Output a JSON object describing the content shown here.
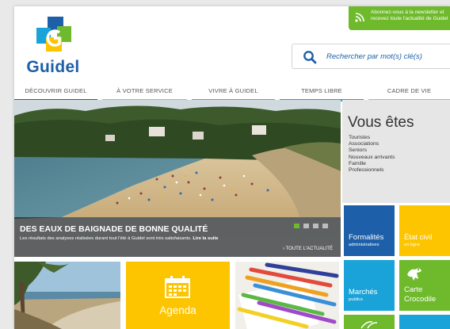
{
  "site": {
    "name": "Guidel"
  },
  "newsletter": {
    "text": "Abonnez-vous à la newsletter et recevez toute l'actualité de Guidel",
    "icon": "rss-icon"
  },
  "search": {
    "placeholder": "Rechercher par mot(s) clé(s)",
    "icon": "search-icon"
  },
  "nav": [
    {
      "label": "DÉCOUVRIR GUIDEL",
      "color": "#1d5fa8"
    },
    {
      "label": "À VOTRE SERVICE",
      "color": "#f5b400"
    },
    {
      "label": "VIVRE À GUIDEL",
      "color": "#6fb92c"
    },
    {
      "label": "TEMPS LIBRE",
      "color": "#1aa3d9"
    },
    {
      "label": "CADRE DE VIE",
      "color": "#9ab8d2"
    }
  ],
  "hero": {
    "title": "DES EAUX DE BAIGNADE DE BONNE QUALITÉ",
    "description": "Les résultats des analyses réalisées durant tout l'été à Guidel sont très satisfaisants.",
    "read_more": "Lire la suite",
    "all_news": "› TOUTE L'ACTUALITÉ",
    "slides_total": 4,
    "slide_active": 1
  },
  "vous_etes": {
    "heading": "Vous êtes",
    "items": [
      "Touristes",
      "Associations",
      "Seniors",
      "Nouveaux arrivants",
      "Famille",
      "Professionnels"
    ]
  },
  "tiles": {
    "formalites": {
      "title": "Formalités",
      "subtitle": "administratives",
      "color": "#1d5fa8"
    },
    "etat_civil": {
      "title": "État civil",
      "subtitle": "en ligne",
      "color": "#fdc400"
    },
    "marches": {
      "title": "Marchés",
      "subtitle": "publics",
      "color": "#1aa3d9"
    },
    "carte": {
      "title": "Carte",
      "subtitle": "Crocodile",
      "color": "#6fb92c",
      "icon": "crocodile-icon"
    }
  },
  "agenda": {
    "label": "Agenda",
    "icon": "calendar-icon"
  }
}
